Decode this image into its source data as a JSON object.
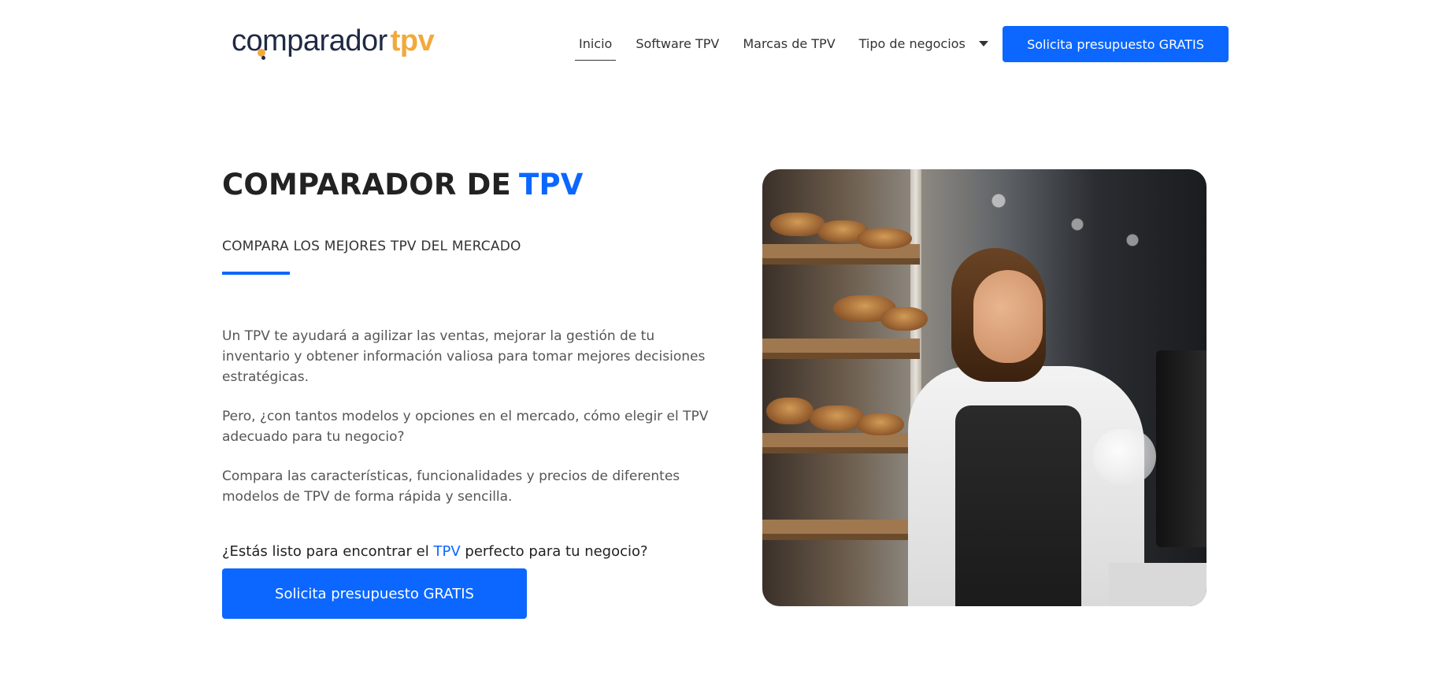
{
  "header": {
    "logo": {
      "part1": "comparador",
      "part2": "tpv"
    },
    "nav": [
      {
        "label": "Inicio",
        "active": true
      },
      {
        "label": "Software TPV",
        "active": false
      },
      {
        "label": "Marcas de TPV",
        "active": false
      },
      {
        "label": "Tipo de negocios",
        "active": false,
        "has_dropdown": true
      }
    ],
    "cta_label": "Solicita presupuesto GRATIS"
  },
  "hero": {
    "title_main": "COMPARADOR DE",
    "title_accent": "TPV",
    "subtitle": "COMPARA LOS MEJORES TPV DEL MERCADO",
    "paragraphs": [
      "Un TPV te ayudará a agilizar las ventas, mejorar la gestión de tu inventario y obtener información valiosa para tomar mejores decisiones estratégicas.",
      "Pero, ¿con tantos modelos y opciones en el mercado, cómo elegir el TPV adecuado para tu negocio?",
      "Compara las características, funcionalidades y precios de diferentes modelos de TPV de forma rápida y sencilla."
    ],
    "question": {
      "before": "¿Estás listo para encontrar el",
      "accent": "TPV",
      "after": "perfecto para tu negocio?"
    },
    "cta_label": "Solicita presupuesto GRATIS",
    "image_alt": "bakery-cashier-photo"
  },
  "colors": {
    "accent": "#0b67ff",
    "logo_orange": "#f2a93b",
    "logo_dark": "#1f2a44"
  }
}
